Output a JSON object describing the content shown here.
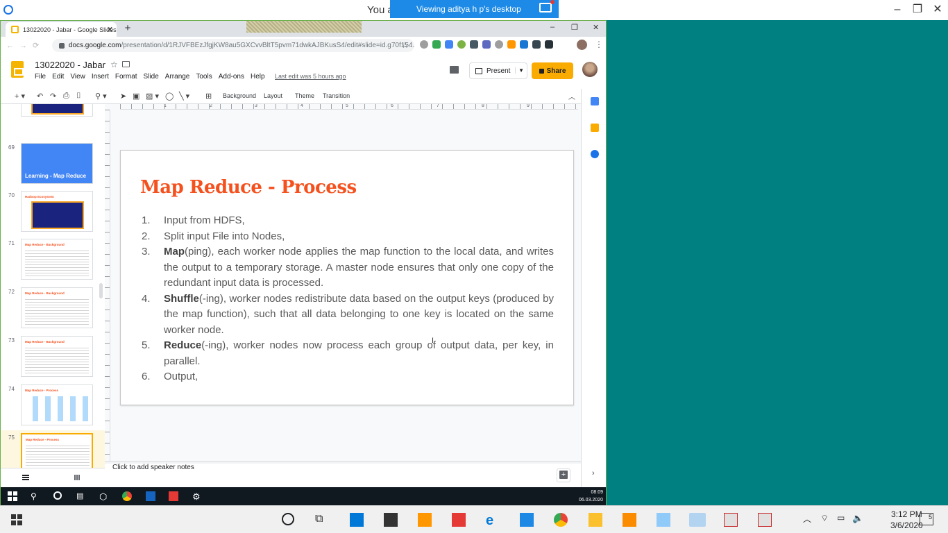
{
  "viewer": {
    "title": "You a",
    "banner_text": "Viewing aditya h p's desktop"
  },
  "browser": {
    "tab_title": "13022020 - Jabar - Google Slides",
    "tab_close": "✕",
    "new_tab": "+",
    "url_host": "docs.google.com",
    "url_path": "/presentation/d/1RJVFBEzJfgjKW8au5GXCvvBltT5pvm71dwkAJBKusS4/edit#slide=id.g70f154..."
  },
  "slides_app": {
    "doc_title": "13022020 - Jabar",
    "menu": [
      "File",
      "Edit",
      "View",
      "Insert",
      "Format",
      "Slide",
      "Arrange",
      "Tools",
      "Add-ons",
      "Help"
    ],
    "last_edit": "Last edit was 5 hours ago",
    "present_label": "Present",
    "share_label": "Share",
    "toolbar": {
      "background": "Background",
      "layout": "Layout",
      "theme": "Theme",
      "transition": "Transition"
    },
    "speaker_notes_placeholder": "Click to add speaker notes",
    "accent_color": "#f4511e",
    "share_color": "#f9ab00"
  },
  "filmstrip": [
    {
      "num": "69",
      "title": "Learning - Map Reduce",
      "style": "blue"
    },
    {
      "num": "70",
      "title": "Hadoop Ecosystem",
      "style": "diagram"
    },
    {
      "num": "71",
      "title": "Map Reduce - Background",
      "style": "text"
    },
    {
      "num": "72",
      "title": "Map Reduce - Background",
      "style": "text"
    },
    {
      "num": "73",
      "title": "Map Reduce - Background",
      "style": "text"
    },
    {
      "num": "74",
      "title": "Map Reduce - Process",
      "style": "flow"
    },
    {
      "num": "75",
      "title": "Map Reduce - Process",
      "style": "text",
      "selected": true
    },
    {
      "num": "76",
      "title": "",
      "style": "text"
    }
  ],
  "slide": {
    "title": "Map Reduce - Process",
    "items": [
      {
        "num": "1.",
        "strong": "",
        "text": "Input from HDFS,"
      },
      {
        "num": "2.",
        "strong": "",
        "text": "Split input File into Nodes,"
      },
      {
        "num": "3.",
        "strong": "Map",
        "text": "(ping), each worker node applies the map function to the local data, and writes the output to a temporary storage. A master node ensures that only one copy of the redundant input data is processed."
      },
      {
        "num": "4.",
        "strong": "Shuffle",
        "text": "(-ing), worker nodes redistribute data based on the output keys (produced by the map function), such that all data belonging to one key is located on the same worker node."
      },
      {
        "num": "5.",
        "strong": "Reduce",
        "text": "(-ing), worker nodes now process each group of output data, per key, in parallel."
      },
      {
        "num": "6.",
        "strong": "",
        "text": "Output,"
      }
    ]
  },
  "ruler": [
    "1",
    "2",
    "3",
    "4",
    "5",
    "6",
    "7",
    "8",
    "9"
  ],
  "remote_clock": {
    "time": "08:09",
    "date": "06.03.2020"
  },
  "local_clock": {
    "time": "3:12 PM",
    "date": "3/6/2020"
  },
  "notification_count": "5"
}
